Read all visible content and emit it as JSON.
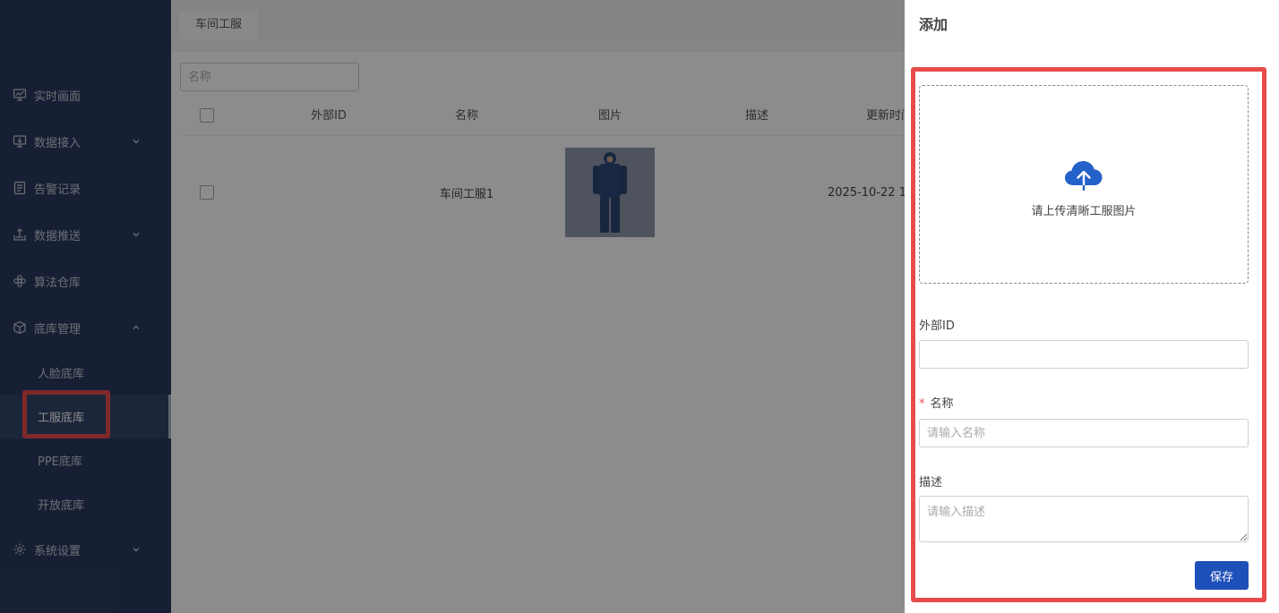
{
  "sidebar": {
    "items": [
      {
        "label": "实时画面",
        "icon": "monitor-chart-icon"
      },
      {
        "label": "数据接入",
        "icon": "data-input-icon",
        "expandable": true
      },
      {
        "label": "告警记录",
        "icon": "document-icon"
      },
      {
        "label": "数据推送",
        "icon": "upload-tray-icon",
        "expandable": true
      },
      {
        "label": "算法仓库",
        "icon": "flower-icon"
      },
      {
        "label": "底库管理",
        "icon": "cube-icon",
        "expanded": true
      },
      {
        "label": "系统设置",
        "icon": "gear-icon",
        "expandable": true
      }
    ],
    "sub_items": [
      "人脸底库",
      "工服底库",
      "PPE底库",
      "开放底库"
    ],
    "active_sub": "工服底库"
  },
  "main": {
    "tab": "车间工服",
    "search_placeholder": "名称",
    "columns": [
      "外部ID",
      "名称",
      "图片",
      "描述",
      "更新时间"
    ],
    "rows": [
      {
        "external_id": "",
        "name": "车间工服1",
        "description": "",
        "updated": "2025-10-22 1"
      }
    ]
  },
  "drawer": {
    "title": "添加",
    "upload_text": "请上传清晰工服图片",
    "external_id_label": "外部ID",
    "external_id_value": "",
    "name_label": "名称",
    "name_placeholder": "请输入名称",
    "required_mark": "*",
    "desc_label": "描述",
    "desc_placeholder": "请输入描述",
    "save_label": "保存"
  },
  "colors": {
    "sidebar_bg": "#2b3a5f",
    "primary": "#1f4fb8",
    "highlight": "#e84b4b"
  }
}
